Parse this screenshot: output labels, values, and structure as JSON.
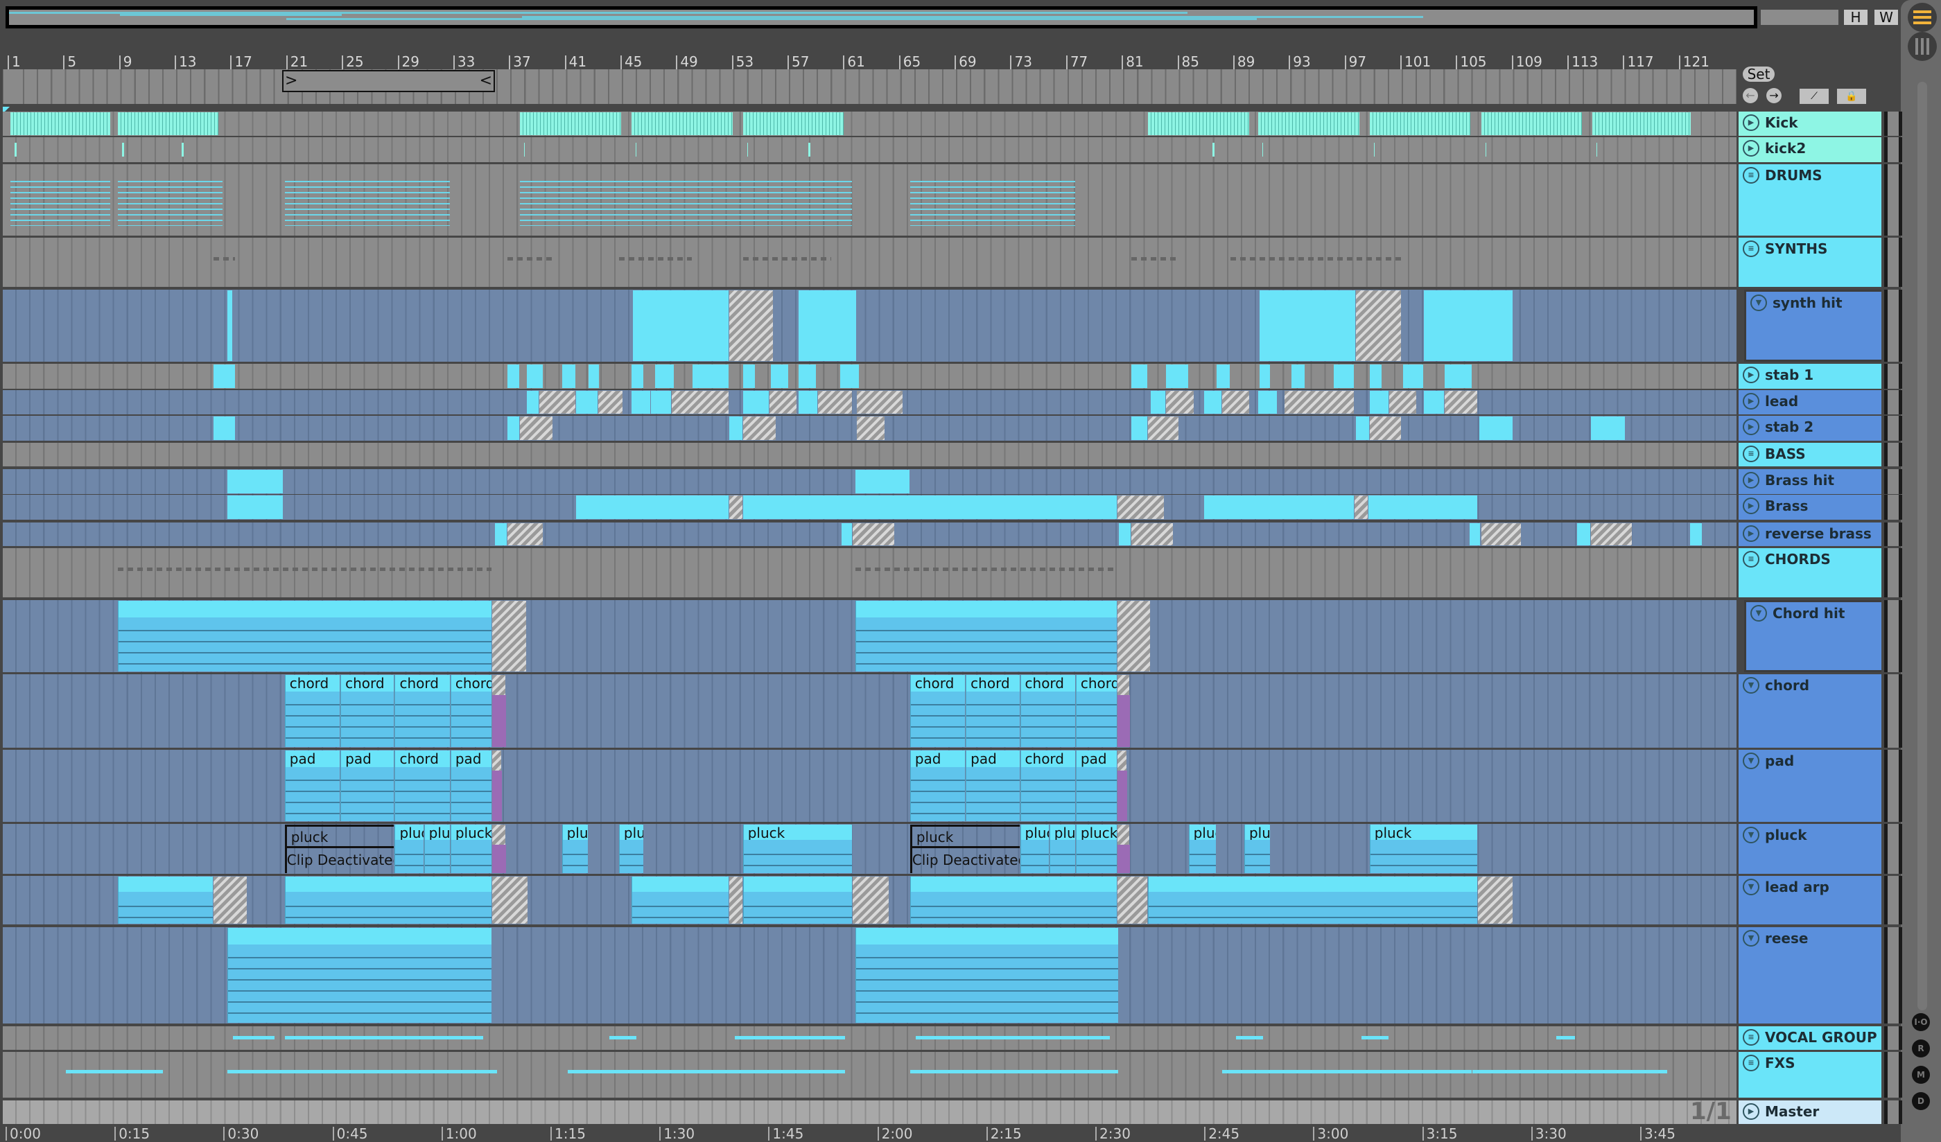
{
  "window_buttons": {
    "h": "H",
    "w": "W"
  },
  "locator": {
    "set_label": "Set",
    "prev_icon": "arrow-left-icon",
    "next_icon": "arrow-right-icon"
  },
  "ruler_bars": [
    "1",
    "5",
    "9",
    "13",
    "17",
    "21",
    "25",
    "29",
    "33",
    "37",
    "41",
    "45",
    "49",
    "53",
    "57",
    "61",
    "65",
    "69",
    "73",
    "77",
    "81",
    "85",
    "89",
    "93",
    "97",
    "101",
    "105",
    "109",
    "113",
    "117",
    "121"
  ],
  "time_labels": [
    "0:00",
    "0:15",
    "0:30",
    "0:45",
    "1:00",
    "1:15",
    "1:30",
    "1:45",
    "2:00",
    "2:15",
    "2:30",
    "2:45",
    "3:00",
    "3:15",
    "3:30",
    "3:45"
  ],
  "page_indicator": "1/1",
  "side_buttons": [
    "I·O",
    "R",
    "M",
    "D"
  ],
  "colors": {
    "teal": "#8ef5e4",
    "cyan": "#6ae4f9",
    "blue": "#5a8fdc",
    "master": "#cce8f8"
  },
  "tracks": [
    {
      "name": "Kick",
      "icon": "play",
      "color": "#8ef5e4",
      "bg": "grey",
      "clips": [
        [
          1,
          8.2,
          "k"
        ],
        [
          8.7,
          16,
          "k"
        ],
        [
          37.6,
          44.9,
          "k"
        ],
        [
          45.6,
          52.9,
          "k"
        ],
        [
          53.6,
          60.9,
          "k"
        ],
        [
          82.7,
          90,
          "k"
        ],
        [
          90.6,
          97.9,
          "k"
        ],
        [
          98.6,
          105.9,
          "k"
        ],
        [
          106.6,
          113.9,
          "k"
        ],
        [
          114.6,
          121.7,
          "k"
        ]
      ]
    },
    {
      "name": "kick2",
      "icon": "play",
      "color": "#8ef5e4",
      "bg": "grey",
      "clips": [
        [
          1,
          1.5,
          "t"
        ],
        [
          8.7,
          9.2,
          "t"
        ],
        [
          13,
          13.5,
          "t"
        ],
        [
          37.6,
          38,
          "t"
        ],
        [
          45.6,
          46,
          "t"
        ],
        [
          53.6,
          54,
          "t"
        ],
        [
          58,
          58.5,
          "t"
        ],
        [
          82.7,
          83,
          "t"
        ],
        [
          87,
          87.5,
          "t"
        ],
        [
          90.6,
          91,
          "t"
        ],
        [
          98.6,
          99,
          "t"
        ],
        [
          106.6,
          107,
          "t"
        ],
        [
          114.6,
          115,
          "t"
        ]
      ]
    },
    {
      "name": "DRUMS",
      "icon": "group",
      "color": "#6ae4f9",
      "bg": "grey",
      "clips": [
        [
          1,
          8.2,
          "m"
        ],
        [
          8.7,
          16.3,
          "m"
        ],
        [
          20.7,
          32.6,
          "m"
        ],
        [
          37.6,
          61.5,
          "m"
        ],
        [
          65.6,
          77.5,
          "m"
        ],
        [
          82.7,
          106
        ],
        "m"
      ]
    },
    {
      "name": "SYNTHS",
      "icon": "group",
      "color": "#6ae4f9",
      "bg": "grey",
      "clips": [
        [
          15.6,
          17.2,
          "g"
        ],
        [
          36.7,
          40,
          "g"
        ],
        [
          44.7,
          50,
          "g"
        ],
        [
          53.6,
          60,
          "g"
        ],
        [
          81.5,
          85,
          "g"
        ],
        [
          88.6,
          100.9,
          "g"
        ]
      ]
    },
    {
      "name": "synth hit",
      "icon": "fold",
      "color": "#5a8fdc",
      "bg": "blue",
      "sub": true,
      "clips": [
        [
          16.6,
          17,
          "s"
        ],
        [
          45.7,
          52.6,
          "s"
        ],
        [
          52.6,
          55.8,
          "h"
        ],
        [
          57.6,
          61.8,
          "s"
        ],
        [
          90.7,
          97.6,
          "s"
        ],
        [
          97.6,
          100.9,
          "h"
        ],
        [
          102.5,
          108.9,
          "s"
        ]
      ]
    },
    {
      "name": "stab 1",
      "icon": "play",
      "color": "#6ae4f9",
      "bg": "grey",
      "clips": [
        [
          15.6,
          17.2,
          "s"
        ],
        [
          36.7,
          37.6,
          "s"
        ],
        [
          38.1,
          39.3,
          "s"
        ],
        [
          40.6,
          41.6,
          "s"
        ],
        [
          42.5,
          43.3,
          "s"
        ],
        [
          45.6,
          46.5,
          "s"
        ],
        [
          47.3,
          48.7,
          "s"
        ],
        [
          50,
          52.6,
          "s"
        ],
        [
          53.6,
          54.5,
          "s"
        ],
        [
          55.6,
          56.9,
          "s"
        ],
        [
          57.6,
          58.9,
          "s"
        ],
        [
          60.6,
          62,
          "s"
        ],
        [
          81.5,
          82.7,
          "s"
        ],
        [
          84,
          85.6,
          "s"
        ],
        [
          87.6,
          88.6,
          "s"
        ],
        [
          90.7,
          91.5,
          "s"
        ],
        [
          93,
          94,
          "s"
        ],
        [
          96,
          97.5,
          "s"
        ],
        [
          98.6,
          99.5,
          "s"
        ],
        [
          101,
          102.5,
          "s"
        ],
        [
          104,
          106,
          "s"
        ]
      ]
    },
    {
      "name": "lead",
      "icon": "play",
      "color": "#5a8fdc",
      "bg": "blue",
      "clips": [
        [
          38.1,
          39,
          "s"
        ],
        [
          39,
          41.6,
          "h"
        ],
        [
          41.6,
          43.2,
          "s"
        ],
        [
          43.2,
          45,
          "h"
        ],
        [
          45.6,
          47,
          "s"
        ],
        [
          47,
          48.5,
          "s"
        ],
        [
          48.5,
          52.6,
          "h"
        ],
        [
          53.6,
          55.5,
          "s"
        ],
        [
          55.5,
          57.5,
          "h"
        ],
        [
          57.6,
          59,
          "s"
        ],
        [
          59,
          61.5,
          "h"
        ],
        [
          61.8,
          65.1,
          "h"
        ],
        [
          82.9,
          84,
          "s"
        ],
        [
          84,
          86,
          "h"
        ],
        [
          86.7,
          88,
          "s"
        ],
        [
          88,
          90,
          "h"
        ],
        [
          90.6,
          92,
          "s"
        ],
        [
          92.5,
          97.5,
          "h"
        ],
        [
          98.6,
          100,
          "s"
        ],
        [
          100,
          102,
          "h"
        ],
        [
          102.5,
          104,
          "s"
        ],
        [
          104,
          106.4,
          "h"
        ]
      ]
    },
    {
      "name": "stab 2",
      "icon": "play",
      "color": "#5a8fdc",
      "bg": "blue",
      "clips": [
        [
          15.6,
          17.2,
          "s"
        ],
        [
          36.7,
          37.6,
          "s"
        ],
        [
          37.6,
          40,
          "h"
        ],
        [
          52.6,
          53.6,
          "s"
        ],
        [
          53.6,
          56,
          "h"
        ],
        [
          61.8,
          63.8,
          "h"
        ],
        [
          81.5,
          82.7,
          "s"
        ],
        [
          82.7,
          84.9,
          "h"
        ],
        [
          97.6,
          98.6,
          "s"
        ],
        [
          98.6,
          100.9,
          "h"
        ],
        [
          106.5,
          108.9,
          "s"
        ],
        [
          114.5,
          117,
          "s"
        ]
      ]
    },
    {
      "name": "BASS",
      "icon": "group",
      "color": "#6ae4f9",
      "bg": "grey",
      "clips": [
        [
          37.6,
          44.9,
          "m"
        ],
        [
          45.6,
          52.9,
          "m"
        ],
        [
          53.6,
          60.6,
          "m"
        ],
        [
          82.7,
          90,
          "m"
        ],
        [
          90.6,
          97.9,
          "m"
        ],
        [
          98.6,
          105.4,
          "m"
        ],
        [
          106.5,
          113.4,
          "m"
        ]
      ]
    },
    {
      "name": "Brass hit",
      "icon": "play",
      "color": "#5a8fdc",
      "bg": "blue",
      "clips": [
        [
          16.6,
          20.6,
          "s"
        ],
        [
          61.7,
          65.6,
          "s"
        ]
      ]
    },
    {
      "name": "Brass",
      "icon": "play",
      "color": "#5a8fdc",
      "bg": "blue",
      "clips": [
        [
          16.6,
          20.6,
          "s"
        ],
        [
          41.6,
          52.6,
          "s"
        ],
        [
          52.6,
          53.6,
          "h"
        ],
        [
          53.6,
          80.5,
          "s"
        ],
        [
          80.5,
          83.9,
          "h"
        ],
        [
          86.7,
          97.5,
          "s"
        ],
        [
          97.5,
          98.5,
          "h"
        ],
        [
          98.5,
          106.4,
          "s"
        ]
      ]
    },
    {
      "name": "reverse brass",
      "icon": "play",
      "color": "#5a8fdc",
      "bg": "blue",
      "clips": [
        [
          35.8,
          36.7,
          "s"
        ],
        [
          36.7,
          39.3,
          "h"
        ],
        [
          60.7,
          61.5,
          "s"
        ],
        [
          61.5,
          64.5,
          "h"
        ],
        [
          80.6,
          81.5,
          "s"
        ],
        [
          81.5,
          84.5,
          "h"
        ],
        [
          105.8,
          106.6,
          "s"
        ],
        [
          106.6,
          109.5,
          "h"
        ],
        [
          113.5,
          114.5,
          "s"
        ],
        [
          114.5,
          117.5,
          "h"
        ],
        [
          121.6,
          122.5,
          "s"
        ]
      ]
    },
    {
      "name": "CHORDS",
      "icon": "group",
      "color": "#6ae4f9",
      "bg": "grey",
      "clips": [
        [
          8.7,
          35.6,
          "g"
        ],
        [
          61.7,
          80.5,
          "g"
        ]
      ]
    },
    {
      "name": "Chord hit",
      "icon": "fold",
      "color": "#5a8fdc",
      "bg": "blue",
      "sub": true,
      "clips": [
        [
          8.7,
          35.6,
          "c",
          ""
        ],
        [
          35.6,
          38.1,
          "h"
        ],
        [
          61.7,
          80.5,
          "c",
          ""
        ],
        [
          80.5,
          82.9,
          "h"
        ]
      ]
    },
    {
      "name": "chord",
      "icon": "fold",
      "color": "#5a8fdc",
      "bg": "blue",
      "clips": [
        [
          20.7,
          24.7,
          "c",
          "chord"
        ],
        [
          24.7,
          28.6,
          "c",
          "chord"
        ],
        [
          28.6,
          32.6,
          "c",
          "chord"
        ],
        [
          32.6,
          35.6,
          "c",
          "chord"
        ],
        [
          35.6,
          36.6,
          "h"
        ],
        [
          65.6,
          69.6,
          "c",
          "chord"
        ],
        [
          69.6,
          73.5,
          "c",
          "chord"
        ],
        [
          73.5,
          77.5,
          "c",
          "chord"
        ],
        [
          77.5,
          80.5,
          "c",
          "chord"
        ],
        [
          80.5,
          81.4,
          "h"
        ]
      ]
    },
    {
      "name": "pad",
      "icon": "fold",
      "color": "#5a8fdc",
      "bg": "blue",
      "clips": [
        [
          20.7,
          24.7,
          "c",
          "pad"
        ],
        [
          24.7,
          28.6,
          "c",
          "pad"
        ],
        [
          28.6,
          32.6,
          "c",
          "chord"
        ],
        [
          32.6,
          35.6,
          "c",
          "pad"
        ],
        [
          35.6,
          36.3,
          "h"
        ],
        [
          65.6,
          69.6,
          "c",
          "pad"
        ],
        [
          69.6,
          73.5,
          "c",
          "pad"
        ],
        [
          73.5,
          77.5,
          "c",
          "chord"
        ],
        [
          77.5,
          80.5,
          "c",
          "pad"
        ],
        [
          80.5,
          81.2,
          "h"
        ]
      ]
    },
    {
      "name": "pluck",
      "icon": "fold",
      "color": "#5a8fdc",
      "bg": "blue",
      "clips": [
        [
          20.7,
          28.6,
          "d",
          "pluck",
          "Clip Deactivated"
        ],
        [
          28.6,
          30.7,
          "c",
          "pluck"
        ],
        [
          30.7,
          32.6,
          "c",
          "pluck"
        ],
        [
          32.6,
          35.6,
          "c",
          "pluck"
        ],
        [
          35.6,
          36.6,
          "h"
        ],
        [
          40.6,
          42.5,
          "c",
          "pluck"
        ],
        [
          44.7,
          46.5,
          "c",
          "pluck"
        ],
        [
          53.6,
          61.5,
          "c",
          "pluck"
        ],
        [
          65.6,
          73.5,
          "d",
          "pluck",
          "Clip Deactivated"
        ],
        [
          73.5,
          75.6,
          "c",
          "pluck"
        ],
        [
          75.6,
          77.5,
          "c",
          "pluck"
        ],
        [
          77.5,
          80.5,
          "c",
          "pluck"
        ],
        [
          80.5,
          81.4,
          "h"
        ],
        [
          85.6,
          87.6,
          "c",
          "pluck"
        ],
        [
          89.6,
          91.5,
          "c",
          "pluck"
        ],
        [
          98.6,
          106.4,
          "c",
          "pluck"
        ]
      ]
    },
    {
      "name": "lead arp",
      "icon": "fold",
      "color": "#5a8fdc",
      "bg": "blue",
      "clips": [
        [
          8.7,
          15.6,
          "c",
          ""
        ],
        [
          15.6,
          18,
          "h"
        ],
        [
          20.7,
          35.6,
          "c",
          ""
        ],
        [
          35.6,
          38.2,
          "h"
        ],
        [
          45.6,
          52.6,
          "c",
          ""
        ],
        [
          52.6,
          53.6,
          "h"
        ],
        [
          53.6,
          61.5,
          "c",
          ""
        ],
        [
          61.5,
          64.1,
          "h"
        ],
        [
          65.6,
          80.5,
          "c",
          ""
        ],
        [
          80.5,
          82.7,
          "h"
        ],
        [
          82.7,
          106.4,
          "c",
          ""
        ],
        [
          106.4,
          108.9,
          "h"
        ]
      ]
    },
    {
      "name": "reese",
      "icon": "fold",
      "color": "#5a8fdc",
      "bg": "blue",
      "clips": [
        [
          16.6,
          35.6,
          "c",
          ""
        ],
        [
          61.7,
          80.6,
          "c",
          ""
        ]
      ]
    },
    {
      "name": "VOCAL GROUP",
      "icon": "group",
      "color": "#6ae4f9",
      "bg": "grey",
      "clips": [
        [
          17,
          20,
          "l"
        ],
        [
          20.7,
          35,
          "l"
        ],
        [
          44,
          46,
          "l"
        ],
        [
          53,
          61,
          "l"
        ],
        [
          66,
          80,
          "l"
        ],
        [
          89,
          91,
          "l"
        ],
        [
          98,
          100,
          "l"
        ],
        [
          112,
          113.4,
          "l"
        ]
      ]
    },
    {
      "name": "FXS",
      "icon": "group",
      "color": "#6ae4f9",
      "bg": "grey",
      "clips": [
        [
          5,
          12,
          "l"
        ],
        [
          16.6,
          36,
          "l"
        ],
        [
          41,
          61,
          "l"
        ],
        [
          65.6,
          80.6,
          "l"
        ],
        [
          88,
          106,
          "l"
        ],
        [
          106,
          120,
          "l"
        ]
      ]
    },
    {
      "name": "Master",
      "icon": "play",
      "color": "#cce8f8",
      "bg": "grey",
      "clips": []
    }
  ]
}
